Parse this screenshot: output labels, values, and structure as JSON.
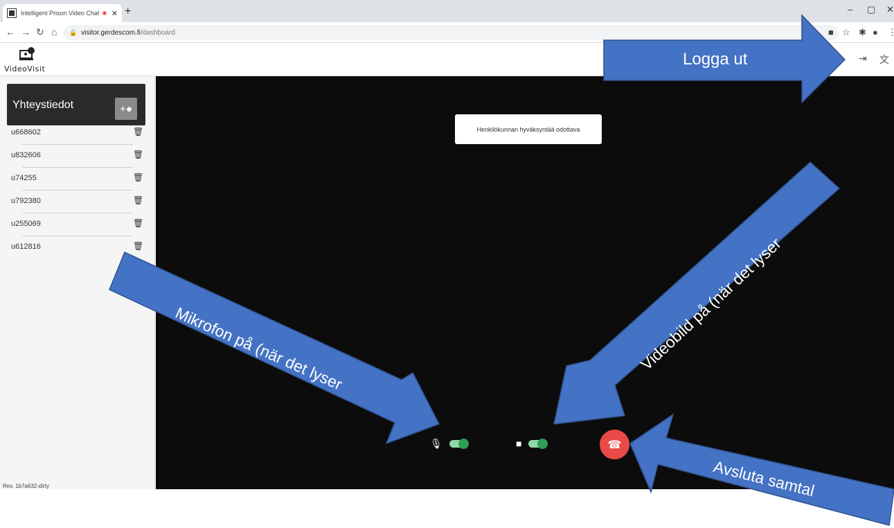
{
  "browser": {
    "tab_title": "Intelligent Prison Video Chat",
    "url_host": "visitor.gerdescom.fi",
    "url_path": "/dashboard"
  },
  "app": {
    "logo_text": "VideoVisit",
    "contacts_title": "Yhteystiedot",
    "contacts": [
      {
        "name": "u668602"
      },
      {
        "name": "u832606"
      },
      {
        "name": "u74255"
      },
      {
        "name": "u792380"
      },
      {
        "name": "u255069"
      },
      {
        "name": "u612816"
      }
    ],
    "revision": "Rev. 1b7a632-dirty",
    "toast": "Henkilökunnan hyväksyntää odottava",
    "controls": {
      "microphone_on": true,
      "camera_on": true
    }
  },
  "annotations": {
    "logout": "Logga ut",
    "video": "Videobild på (när det lyser",
    "microphone": "Mikrofon på (när det lyser",
    "hangup": "Avsluta samtal"
  },
  "colors": {
    "arrow_fill": "#4472c4",
    "arrow_stroke": "#2f528f",
    "video_bg": "#0c0c0c",
    "toggle_on": "#2e9e56",
    "hangup": "#e84a48"
  }
}
